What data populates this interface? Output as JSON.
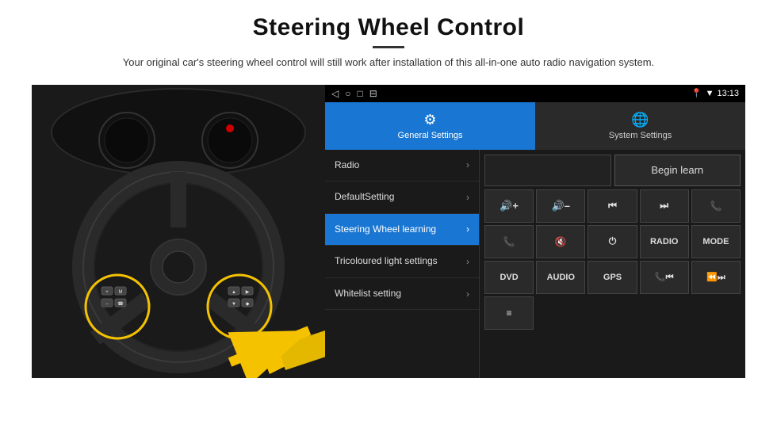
{
  "header": {
    "title": "Steering Wheel Control",
    "subtitle": "Your original car's steering wheel control will still work after installation of this all-in-one auto radio navigation system."
  },
  "status_bar": {
    "time": "13:13",
    "nav_icons": [
      "◁",
      "○",
      "□",
      "⊟"
    ]
  },
  "tabs": [
    {
      "id": "general",
      "label": "General Settings",
      "icon": "⚙",
      "active": true
    },
    {
      "id": "system",
      "label": "System Settings",
      "icon": "🌐",
      "active": false
    }
  ],
  "menu_items": [
    {
      "id": "radio",
      "label": "Radio",
      "active": false
    },
    {
      "id": "default",
      "label": "DefaultSetting",
      "active": false
    },
    {
      "id": "steering",
      "label": "Steering Wheel learning",
      "active": true
    },
    {
      "id": "tricoloured",
      "label": "Tricoloured light settings",
      "active": false
    },
    {
      "id": "whitelist",
      "label": "Whitelist setting",
      "active": false
    }
  ],
  "controls": {
    "begin_learn_label": "Begin learn",
    "rows": [
      [
        {
          "id": "vol_up",
          "label": "◀+",
          "type": "text"
        },
        {
          "id": "vol_down",
          "label": "◀–",
          "type": "text"
        },
        {
          "id": "prev",
          "label": "⏮",
          "type": "icon"
        },
        {
          "id": "next",
          "label": "⏭",
          "type": "icon"
        },
        {
          "id": "phone",
          "label": "✆",
          "type": "icon"
        }
      ],
      [
        {
          "id": "call",
          "label": "📞",
          "type": "icon"
        },
        {
          "id": "mute",
          "label": "🔇",
          "type": "icon"
        },
        {
          "id": "power",
          "label": "⏻",
          "type": "icon"
        },
        {
          "id": "radio_btn",
          "label": "RADIO",
          "type": "text"
        },
        {
          "id": "mode",
          "label": "MODE",
          "type": "text"
        }
      ],
      [
        {
          "id": "dvd",
          "label": "DVD",
          "type": "text"
        },
        {
          "id": "audio",
          "label": "AUDIO",
          "type": "text"
        },
        {
          "id": "gps",
          "label": "GPS",
          "type": "text"
        },
        {
          "id": "phone2",
          "label": "✆⏮",
          "type": "text"
        },
        {
          "id": "seek",
          "label": "⏪⏭",
          "type": "text"
        }
      ],
      [
        {
          "id": "extra",
          "label": "≡",
          "type": "icon"
        }
      ]
    ]
  }
}
